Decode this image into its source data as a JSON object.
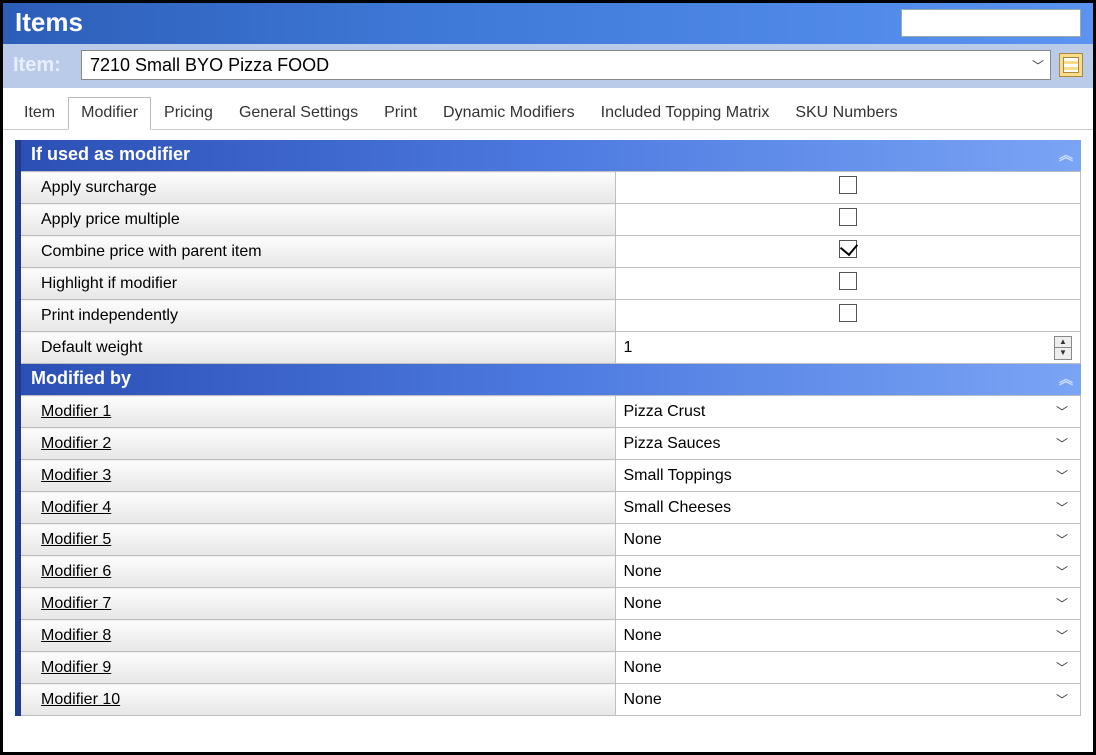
{
  "header": {
    "title": "Items"
  },
  "item_selector": {
    "label": "Item:",
    "value": "7210 Small BYO Pizza FOOD"
  },
  "tabs": [
    {
      "label": "Item",
      "active": false
    },
    {
      "label": "Modifier",
      "active": true
    },
    {
      "label": "Pricing",
      "active": false
    },
    {
      "label": "General Settings",
      "active": false
    },
    {
      "label": "Print",
      "active": false
    },
    {
      "label": "Dynamic Modifiers",
      "active": false
    },
    {
      "label": "Included Topping Matrix",
      "active": false
    },
    {
      "label": "SKU Numbers",
      "active": false
    }
  ],
  "section_if_used": {
    "title": "If used as modifier",
    "rows": [
      {
        "label": "Apply surcharge",
        "type": "check",
        "checked": false
      },
      {
        "label": "Apply price multiple",
        "type": "check",
        "checked": false
      },
      {
        "label": "Combine price with parent item",
        "type": "check",
        "checked": true
      },
      {
        "label": "Highlight if modifier",
        "type": "check",
        "checked": false
      },
      {
        "label": "Print independently",
        "type": "check",
        "checked": false
      },
      {
        "label": "Default weight",
        "type": "spinner",
        "value": "1"
      }
    ]
  },
  "section_modified_by": {
    "title": "Modified by",
    "rows": [
      {
        "label": "Modifier 1",
        "value": "Pizza Crust"
      },
      {
        "label": "Modifier 2",
        "value": "Pizza Sauces"
      },
      {
        "label": "Modifier 3",
        "value": "Small Toppings"
      },
      {
        "label": "Modifier 4",
        "value": "Small Cheeses"
      },
      {
        "label": "Modifier 5",
        "value": "None"
      },
      {
        "label": "Modifier 6",
        "value": "None"
      },
      {
        "label": "Modifier 7",
        "value": "None"
      },
      {
        "label": "Modifier 8",
        "value": "None"
      },
      {
        "label": "Modifier 9",
        "value": "None"
      },
      {
        "label": "Modifier 10",
        "value": "None"
      }
    ]
  }
}
